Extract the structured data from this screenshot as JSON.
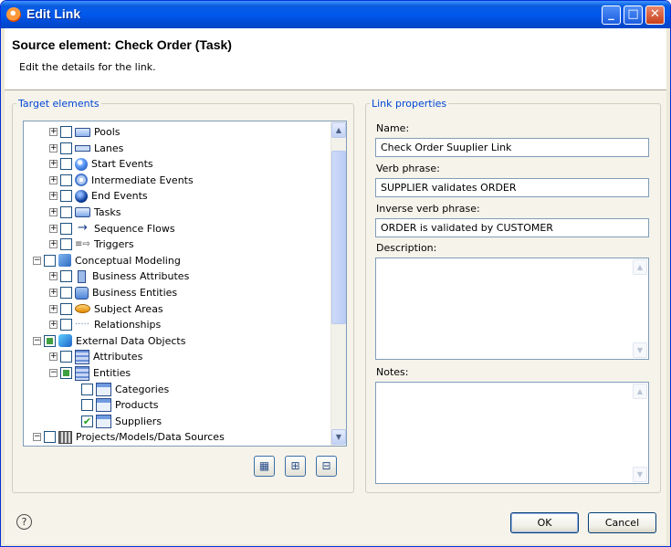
{
  "window": {
    "title": "Edit Link"
  },
  "header": {
    "title": "Source element: Check Order (Task)",
    "subtitle": "Edit the details for the link."
  },
  "target": {
    "legend": "Target elements",
    "items": [
      {
        "label": "Pools",
        "icon": "pool-icon",
        "level": 2,
        "expander": "+",
        "check": "none"
      },
      {
        "label": "Lanes",
        "icon": "lane-icon",
        "level": 2,
        "expander": "+",
        "check": "none"
      },
      {
        "label": "Start Events",
        "icon": "start-event-icon",
        "level": 2,
        "expander": "+",
        "check": "none"
      },
      {
        "label": "Intermediate Events",
        "icon": "intermediate-event-icon",
        "level": 2,
        "expander": "+",
        "check": "none"
      },
      {
        "label": "End Events",
        "icon": "end-event-icon",
        "level": 2,
        "expander": "+",
        "check": "none"
      },
      {
        "label": "Tasks",
        "icon": "task-icon",
        "level": 2,
        "expander": "+",
        "check": "none"
      },
      {
        "label": "Sequence Flows",
        "icon": "sequence-flow-icon",
        "level": 2,
        "expander": "+",
        "check": "none"
      },
      {
        "label": "Triggers",
        "icon": "trigger-icon",
        "level": 2,
        "expander": "+",
        "check": "none"
      },
      {
        "label": "Conceptual Modeling",
        "icon": "conceptual-modeling-icon",
        "level": 1,
        "expander": "-",
        "check": "none"
      },
      {
        "label": "Business Attributes",
        "icon": "business-attribute-icon",
        "level": 2,
        "expander": "+",
        "check": "none"
      },
      {
        "label": "Business Entities",
        "icon": "business-entity-icon",
        "level": 2,
        "expander": "+",
        "check": "none"
      },
      {
        "label": "Subject Areas",
        "icon": "subject-area-icon",
        "level": 2,
        "expander": "+",
        "check": "none"
      },
      {
        "label": "Relationships",
        "icon": "relationship-icon",
        "level": 2,
        "expander": "+",
        "check": "none"
      },
      {
        "label": "External Data Objects",
        "icon": "external-data-objects-icon",
        "level": 1,
        "expander": "-",
        "check": "partial"
      },
      {
        "label": "Attributes",
        "icon": "attributes-icon",
        "level": 2,
        "expander": "+",
        "check": "none"
      },
      {
        "label": "Entities",
        "icon": "entities-icon",
        "level": 2,
        "expander": "-",
        "check": "partial"
      },
      {
        "label": "Categories",
        "icon": "table-icon",
        "level": 3,
        "expander": "",
        "check": "none"
      },
      {
        "label": "Products",
        "icon": "table-icon",
        "level": 3,
        "expander": "",
        "check": "none"
      },
      {
        "label": "Suppliers",
        "icon": "table-icon",
        "level": 3,
        "expander": "",
        "check": "checked"
      },
      {
        "label": "Projects/Models/Data Sources",
        "icon": "projects-icon",
        "level": 1,
        "expander": "-",
        "check": "none"
      }
    ]
  },
  "link_properties": {
    "legend": "Link properties",
    "name_label": "Name:",
    "name_value": "Check Order Suuplier Link",
    "verb_label": "Verb phrase:",
    "verb_value": "SUPPLIER validates ORDER",
    "inverse_label": "Inverse verb phrase:",
    "inverse_value": "ORDER is validated by CUSTOMER",
    "description_label": "Description:",
    "description_value": "",
    "notes_label": "Notes:",
    "notes_value": ""
  },
  "buttons": {
    "ok": "OK",
    "cancel": "Cancel"
  }
}
